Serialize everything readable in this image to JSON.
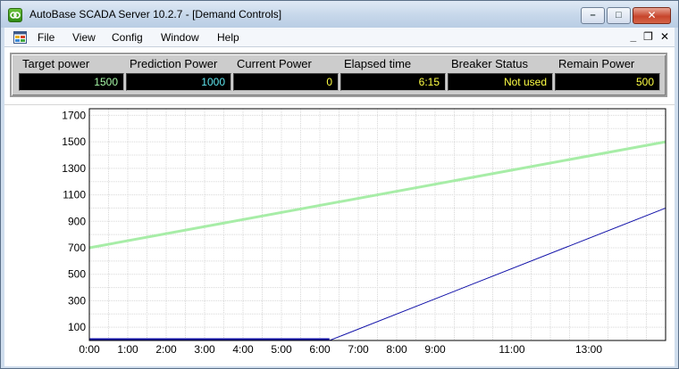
{
  "window": {
    "title": "AutoBase SCADA Server 10.2.7 - [Demand Controls]",
    "minimize_glyph": "–",
    "maximize_glyph": "□",
    "close_glyph": "✕"
  },
  "menu": {
    "items": [
      "File",
      "View",
      "Config",
      "Window",
      "Help"
    ],
    "mdi_minimize": "_",
    "mdi_restore": "❐",
    "mdi_close": "✕"
  },
  "indicators": [
    {
      "label": "Target power",
      "value": "1500",
      "color": "#a6f7a6"
    },
    {
      "label": "Prediction Power",
      "value": "1000",
      "color": "#5fe7f0"
    },
    {
      "label": "Current Power",
      "value": "0",
      "color": "#ffff44"
    },
    {
      "label": "Elapsed time",
      "value": "6:15",
      "color": "#ffff44"
    },
    {
      "label": "Breaker Status",
      "value": "Not used",
      "color": "#ffff44"
    },
    {
      "label": "Remain Power",
      "value": "500",
      "color": "#ffff44"
    }
  ],
  "chart_data": {
    "type": "line",
    "y_ticks": [
      100,
      300,
      500,
      700,
      900,
      1100,
      1300,
      1500,
      1700
    ],
    "ylim": [
      0,
      1750
    ],
    "x_tick_labels": [
      "0:00",
      "1:00",
      "2:00",
      "3:00",
      "4:00",
      "5:00",
      "6:00",
      "7:00",
      "8:00",
      "9:00",
      "11:00",
      "13:00"
    ],
    "x_tick_minutes": [
      0,
      60,
      120,
      180,
      240,
      300,
      360,
      420,
      480,
      540,
      660,
      780
    ],
    "xlim_minutes": [
      0,
      900
    ],
    "grid": true,
    "series": [
      {
        "color": "#a7eda7",
        "points": [
          [
            0,
            700
          ],
          [
            900,
            1500
          ]
        ]
      },
      {
        "color": "#1010a8",
        "points": [
          [
            0,
            0
          ],
          [
            375,
            0
          ],
          [
            900,
            1000
          ]
        ]
      }
    ]
  }
}
